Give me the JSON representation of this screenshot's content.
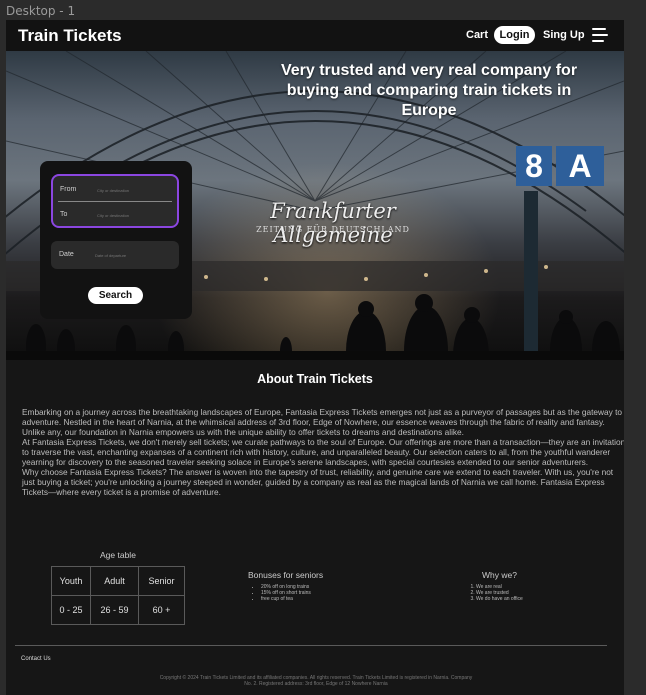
{
  "canvas": {
    "frame_label": "Desktop - 1"
  },
  "nav": {
    "brand": "Train Tickets",
    "cart": "Cart",
    "login": "Login",
    "signup": "Sing Up",
    "menu_icon": "hamburger-menu-icon"
  },
  "hero": {
    "headline": "Very trusted and very real company for buying and comparing train tickets in Europe",
    "station_sign": "Frankfurter Allgemeine",
    "station_sign_sub": "ZEITUNG FÜR DEUTSCHLAND",
    "platform_sign": [
      "8",
      "A"
    ]
  },
  "booking": {
    "from_label": "From",
    "from_placeholder": "City or destination",
    "to_label": "To",
    "to_placeholder": "City or destination",
    "date_label": "Date",
    "date_placeholder": "Date of departure",
    "search_button": "Search"
  },
  "about": {
    "title": "About Train Tickets",
    "paragraphs": [
      "Embarking on a journey across the breathtaking landscapes of Europe, Fantasia Express Tickets emerges not just as a purveyor of passages but as the gateway to adventure. Nestled in the heart of Narnia, at the whimsical address of 3rd floor, Edge of Nowhere, our essence weaves through the fabric of reality and fantasy. Unlike any, our foundation in Narnia empowers us with the unique ability to offer tickets to dreams and destinations alike.",
      "At Fantasia Express Tickets, we don't merely sell tickets; we curate pathways to the soul of Europe. Our offerings are more than a transaction—they are an invitation to traverse the vast, enchanting expanses of a continent rich with history, culture, and unparalleled beauty. Our selection caters to all, from the youthful wanderer yearning for discovery to the seasoned traveler seeking solace in Europe's serene landscapes, with special courtesies extended to our senior adventurers.",
      "Why choose Fantasia Express Tickets? The answer is woven into the tapestry of trust, reliability, and genuine care we extend to each traveler. With us, you're not just buying a ticket; you're unlocking a journey steeped in wonder, guided by a company as real as the magical lands of Narnia we call home. Fantasia Express Tickets—where every ticket is a promise of adventure."
    ]
  },
  "age_table": {
    "caption": "Age table",
    "headers": [
      "Youth",
      "Adult",
      "Senior"
    ],
    "values": [
      "0 - 25",
      "26 - 59",
      "60 +"
    ]
  },
  "bonuses": {
    "title": "Bonuses for seniors",
    "items": [
      "20% off on long trains",
      "15% off on short trains",
      "free cup of tea"
    ]
  },
  "why": {
    "title": "Why we?",
    "items": [
      "We are real",
      "We are trusted",
      "We do have an office"
    ]
  },
  "footer": {
    "contact": "Contact Us",
    "copyright_1": "Copyright © 2024 Train Tickets Limited and its affiliated companies. All rights reserved. Train Tickets Limited is registered in Narnia. Company",
    "copyright_2": "No. 2. Registered address: 3rd floor, Edge of 12 Nowhere Narnia"
  }
}
